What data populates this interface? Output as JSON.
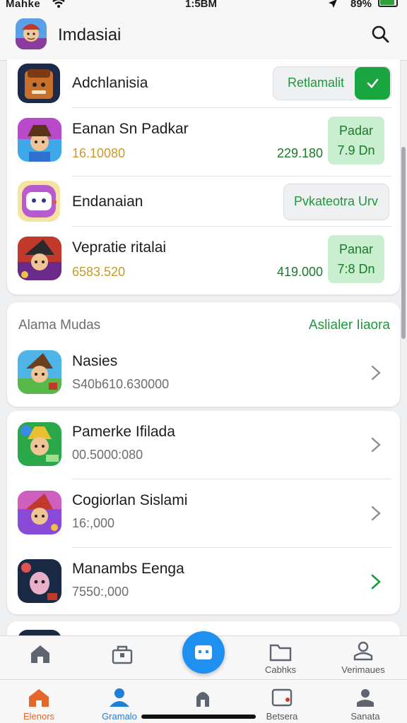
{
  "status_bar": {
    "carrier": "Mahke",
    "time": "1:5BM",
    "battery": "89%"
  },
  "header": {
    "title": "Imdasiai"
  },
  "featured": {
    "rows": [
      {
        "name": "Adchlanisia",
        "pill": "Retlamalit"
      },
      {
        "name": "Eanan Sn Padkar",
        "sub": "16.10080",
        "price": "229.180",
        "btn_line1": "Padar",
        "btn_line2": "7.9 Dn"
      },
      {
        "name": "Endanaian",
        "pill": "Pvkateotra Urv"
      },
      {
        "name": "Vepratie ritalai",
        "sub": "6583.520",
        "price": "419.000",
        "btn_line1": "Panar",
        "btn_line2": "7:8 Dn"
      }
    ]
  },
  "section": {
    "left_label": "Alama Mudas",
    "right_label": "Aslialer Iiaora",
    "rows": [
      {
        "name": "Nasies",
        "sub": "S40b610.630000"
      }
    ]
  },
  "list": {
    "rows": [
      {
        "name": "Pamerke Ifilada",
        "sub": "00.5000:080"
      },
      {
        "name": "Cogiorlan Sislami",
        "sub": "16:,000"
      },
      {
        "name": "Manambs Eenga",
        "sub": "7550:,000"
      }
    ]
  },
  "tabbar_top": [
    {
      "label": ""
    },
    {
      "label": ""
    },
    {
      "label": "Cabhks"
    },
    {
      "label": "Verimaues"
    }
  ],
  "tabbar_bottom": [
    {
      "label": "Elenors"
    },
    {
      "label": "Gramalo"
    },
    {
      "label": ""
    },
    {
      "label": "Betsera"
    },
    {
      "label": "Sanata"
    }
  ],
  "colors": {
    "accent_green": "#19a540",
    "accent_blue": "#1f8ff0",
    "accent_orange": "#e3672a"
  }
}
